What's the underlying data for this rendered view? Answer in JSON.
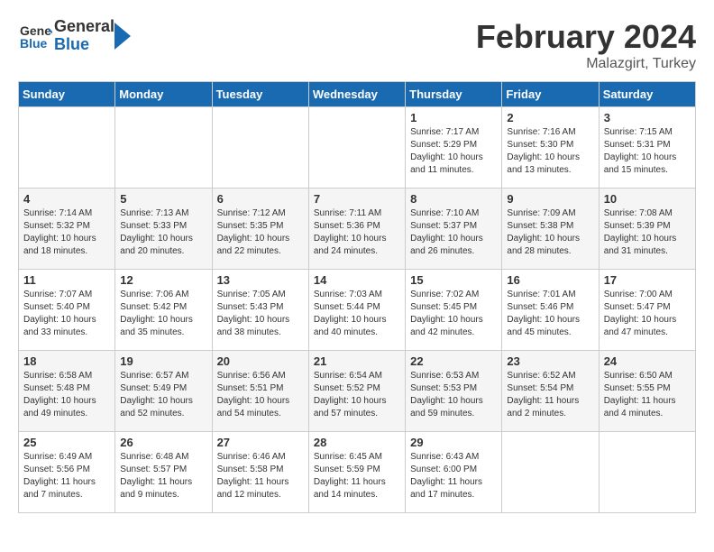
{
  "header": {
    "logo_general": "General",
    "logo_blue": "Blue",
    "main_title": "February 2024",
    "subtitle": "Malazgirt, Turkey"
  },
  "days_of_week": [
    "Sunday",
    "Monday",
    "Tuesday",
    "Wednesday",
    "Thursday",
    "Friday",
    "Saturday"
  ],
  "weeks": [
    {
      "days": [
        {
          "num": "",
          "info": ""
        },
        {
          "num": "",
          "info": ""
        },
        {
          "num": "",
          "info": ""
        },
        {
          "num": "",
          "info": ""
        },
        {
          "num": "1",
          "info": "Sunrise: 7:17 AM\nSunset: 5:29 PM\nDaylight: 10 hours\nand 11 minutes."
        },
        {
          "num": "2",
          "info": "Sunrise: 7:16 AM\nSunset: 5:30 PM\nDaylight: 10 hours\nand 13 minutes."
        },
        {
          "num": "3",
          "info": "Sunrise: 7:15 AM\nSunset: 5:31 PM\nDaylight: 10 hours\nand 15 minutes."
        }
      ]
    },
    {
      "days": [
        {
          "num": "4",
          "info": "Sunrise: 7:14 AM\nSunset: 5:32 PM\nDaylight: 10 hours\nand 18 minutes."
        },
        {
          "num": "5",
          "info": "Sunrise: 7:13 AM\nSunset: 5:33 PM\nDaylight: 10 hours\nand 20 minutes."
        },
        {
          "num": "6",
          "info": "Sunrise: 7:12 AM\nSunset: 5:35 PM\nDaylight: 10 hours\nand 22 minutes."
        },
        {
          "num": "7",
          "info": "Sunrise: 7:11 AM\nSunset: 5:36 PM\nDaylight: 10 hours\nand 24 minutes."
        },
        {
          "num": "8",
          "info": "Sunrise: 7:10 AM\nSunset: 5:37 PM\nDaylight: 10 hours\nand 26 minutes."
        },
        {
          "num": "9",
          "info": "Sunrise: 7:09 AM\nSunset: 5:38 PM\nDaylight: 10 hours\nand 28 minutes."
        },
        {
          "num": "10",
          "info": "Sunrise: 7:08 AM\nSunset: 5:39 PM\nDaylight: 10 hours\nand 31 minutes."
        }
      ]
    },
    {
      "days": [
        {
          "num": "11",
          "info": "Sunrise: 7:07 AM\nSunset: 5:40 PM\nDaylight: 10 hours\nand 33 minutes."
        },
        {
          "num": "12",
          "info": "Sunrise: 7:06 AM\nSunset: 5:42 PM\nDaylight: 10 hours\nand 35 minutes."
        },
        {
          "num": "13",
          "info": "Sunrise: 7:05 AM\nSunset: 5:43 PM\nDaylight: 10 hours\nand 38 minutes."
        },
        {
          "num": "14",
          "info": "Sunrise: 7:03 AM\nSunset: 5:44 PM\nDaylight: 10 hours\nand 40 minutes."
        },
        {
          "num": "15",
          "info": "Sunrise: 7:02 AM\nSunset: 5:45 PM\nDaylight: 10 hours\nand 42 minutes."
        },
        {
          "num": "16",
          "info": "Sunrise: 7:01 AM\nSunset: 5:46 PM\nDaylight: 10 hours\nand 45 minutes."
        },
        {
          "num": "17",
          "info": "Sunrise: 7:00 AM\nSunset: 5:47 PM\nDaylight: 10 hours\nand 47 minutes."
        }
      ]
    },
    {
      "days": [
        {
          "num": "18",
          "info": "Sunrise: 6:58 AM\nSunset: 5:48 PM\nDaylight: 10 hours\nand 49 minutes."
        },
        {
          "num": "19",
          "info": "Sunrise: 6:57 AM\nSunset: 5:49 PM\nDaylight: 10 hours\nand 52 minutes."
        },
        {
          "num": "20",
          "info": "Sunrise: 6:56 AM\nSunset: 5:51 PM\nDaylight: 10 hours\nand 54 minutes."
        },
        {
          "num": "21",
          "info": "Sunrise: 6:54 AM\nSunset: 5:52 PM\nDaylight: 10 hours\nand 57 minutes."
        },
        {
          "num": "22",
          "info": "Sunrise: 6:53 AM\nSunset: 5:53 PM\nDaylight: 10 hours\nand 59 minutes."
        },
        {
          "num": "23",
          "info": "Sunrise: 6:52 AM\nSunset: 5:54 PM\nDaylight: 11 hours\nand 2 minutes."
        },
        {
          "num": "24",
          "info": "Sunrise: 6:50 AM\nSunset: 5:55 PM\nDaylight: 11 hours\nand 4 minutes."
        }
      ]
    },
    {
      "days": [
        {
          "num": "25",
          "info": "Sunrise: 6:49 AM\nSunset: 5:56 PM\nDaylight: 11 hours\nand 7 minutes."
        },
        {
          "num": "26",
          "info": "Sunrise: 6:48 AM\nSunset: 5:57 PM\nDaylight: 11 hours\nand 9 minutes."
        },
        {
          "num": "27",
          "info": "Sunrise: 6:46 AM\nSunset: 5:58 PM\nDaylight: 11 hours\nand 12 minutes."
        },
        {
          "num": "28",
          "info": "Sunrise: 6:45 AM\nSunset: 5:59 PM\nDaylight: 11 hours\nand 14 minutes."
        },
        {
          "num": "29",
          "info": "Sunrise: 6:43 AM\nSunset: 6:00 PM\nDaylight: 11 hours\nand 17 minutes."
        },
        {
          "num": "",
          "info": ""
        },
        {
          "num": "",
          "info": ""
        }
      ]
    }
  ]
}
